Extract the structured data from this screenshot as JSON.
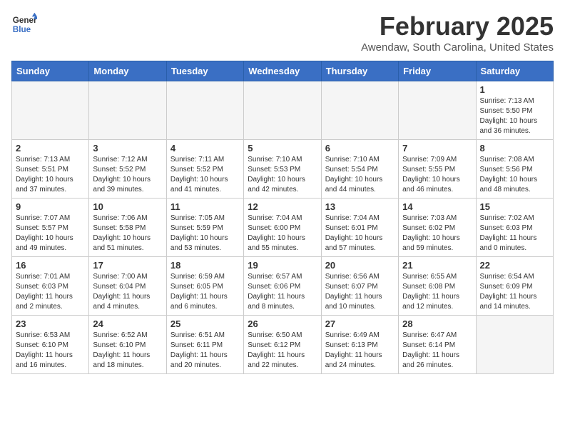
{
  "header": {
    "logo_general": "General",
    "logo_blue": "Blue",
    "month": "February 2025",
    "location": "Awendaw, South Carolina, United States"
  },
  "weekdays": [
    "Sunday",
    "Monday",
    "Tuesday",
    "Wednesday",
    "Thursday",
    "Friday",
    "Saturday"
  ],
  "weeks": [
    [
      {
        "day": "",
        "info": ""
      },
      {
        "day": "",
        "info": ""
      },
      {
        "day": "",
        "info": ""
      },
      {
        "day": "",
        "info": ""
      },
      {
        "day": "",
        "info": ""
      },
      {
        "day": "",
        "info": ""
      },
      {
        "day": "1",
        "info": "Sunrise: 7:13 AM\nSunset: 5:50 PM\nDaylight: 10 hours\nand 36 minutes."
      }
    ],
    [
      {
        "day": "2",
        "info": "Sunrise: 7:13 AM\nSunset: 5:51 PM\nDaylight: 10 hours\nand 37 minutes."
      },
      {
        "day": "3",
        "info": "Sunrise: 7:12 AM\nSunset: 5:52 PM\nDaylight: 10 hours\nand 39 minutes."
      },
      {
        "day": "4",
        "info": "Sunrise: 7:11 AM\nSunset: 5:52 PM\nDaylight: 10 hours\nand 41 minutes."
      },
      {
        "day": "5",
        "info": "Sunrise: 7:10 AM\nSunset: 5:53 PM\nDaylight: 10 hours\nand 42 minutes."
      },
      {
        "day": "6",
        "info": "Sunrise: 7:10 AM\nSunset: 5:54 PM\nDaylight: 10 hours\nand 44 minutes."
      },
      {
        "day": "7",
        "info": "Sunrise: 7:09 AM\nSunset: 5:55 PM\nDaylight: 10 hours\nand 46 minutes."
      },
      {
        "day": "8",
        "info": "Sunrise: 7:08 AM\nSunset: 5:56 PM\nDaylight: 10 hours\nand 48 minutes."
      }
    ],
    [
      {
        "day": "9",
        "info": "Sunrise: 7:07 AM\nSunset: 5:57 PM\nDaylight: 10 hours\nand 49 minutes."
      },
      {
        "day": "10",
        "info": "Sunrise: 7:06 AM\nSunset: 5:58 PM\nDaylight: 10 hours\nand 51 minutes."
      },
      {
        "day": "11",
        "info": "Sunrise: 7:05 AM\nSunset: 5:59 PM\nDaylight: 10 hours\nand 53 minutes."
      },
      {
        "day": "12",
        "info": "Sunrise: 7:04 AM\nSunset: 6:00 PM\nDaylight: 10 hours\nand 55 minutes."
      },
      {
        "day": "13",
        "info": "Sunrise: 7:04 AM\nSunset: 6:01 PM\nDaylight: 10 hours\nand 57 minutes."
      },
      {
        "day": "14",
        "info": "Sunrise: 7:03 AM\nSunset: 6:02 PM\nDaylight: 10 hours\nand 59 minutes."
      },
      {
        "day": "15",
        "info": "Sunrise: 7:02 AM\nSunset: 6:03 PM\nDaylight: 11 hours\nand 0 minutes."
      }
    ],
    [
      {
        "day": "16",
        "info": "Sunrise: 7:01 AM\nSunset: 6:03 PM\nDaylight: 11 hours\nand 2 minutes."
      },
      {
        "day": "17",
        "info": "Sunrise: 7:00 AM\nSunset: 6:04 PM\nDaylight: 11 hours\nand 4 minutes."
      },
      {
        "day": "18",
        "info": "Sunrise: 6:59 AM\nSunset: 6:05 PM\nDaylight: 11 hours\nand 6 minutes."
      },
      {
        "day": "19",
        "info": "Sunrise: 6:57 AM\nSunset: 6:06 PM\nDaylight: 11 hours\nand 8 minutes."
      },
      {
        "day": "20",
        "info": "Sunrise: 6:56 AM\nSunset: 6:07 PM\nDaylight: 11 hours\nand 10 minutes."
      },
      {
        "day": "21",
        "info": "Sunrise: 6:55 AM\nSunset: 6:08 PM\nDaylight: 11 hours\nand 12 minutes."
      },
      {
        "day": "22",
        "info": "Sunrise: 6:54 AM\nSunset: 6:09 PM\nDaylight: 11 hours\nand 14 minutes."
      }
    ],
    [
      {
        "day": "23",
        "info": "Sunrise: 6:53 AM\nSunset: 6:10 PM\nDaylight: 11 hours\nand 16 minutes."
      },
      {
        "day": "24",
        "info": "Sunrise: 6:52 AM\nSunset: 6:10 PM\nDaylight: 11 hours\nand 18 minutes."
      },
      {
        "day": "25",
        "info": "Sunrise: 6:51 AM\nSunset: 6:11 PM\nDaylight: 11 hours\nand 20 minutes."
      },
      {
        "day": "26",
        "info": "Sunrise: 6:50 AM\nSunset: 6:12 PM\nDaylight: 11 hours\nand 22 minutes."
      },
      {
        "day": "27",
        "info": "Sunrise: 6:49 AM\nSunset: 6:13 PM\nDaylight: 11 hours\nand 24 minutes."
      },
      {
        "day": "28",
        "info": "Sunrise: 6:47 AM\nSunset: 6:14 PM\nDaylight: 11 hours\nand 26 minutes."
      },
      {
        "day": "",
        "info": ""
      }
    ]
  ]
}
